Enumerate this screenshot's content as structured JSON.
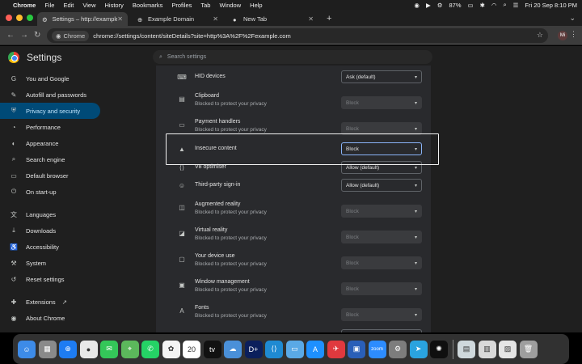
{
  "menubar": {
    "app": "Chrome",
    "items": [
      "File",
      "Edit",
      "View",
      "History",
      "Bookmarks",
      "Profiles",
      "Tab",
      "Window",
      "Help"
    ],
    "battery": "87%",
    "datetime": "Fri 20 Sep  8:10 PM"
  },
  "tabs": [
    {
      "title": "Settings – http://example.co",
      "active": true
    },
    {
      "title": "Example Domain",
      "active": false
    },
    {
      "title": "New Tab",
      "active": false
    }
  ],
  "toolbar": {
    "chip_label": "Chrome",
    "url": "chrome://settings/content/siteDetails?site=http%3A%2F%2Fexample.com",
    "avatar": "Mi"
  },
  "settings": {
    "title": "Settings",
    "search_placeholder": "Search settings",
    "nav": [
      {
        "label": "You and Google",
        "icon": "google-icon"
      },
      {
        "label": "Autofill and passwords",
        "icon": "autofill-icon"
      },
      {
        "label": "Privacy and security",
        "icon": "shield-icon",
        "active": true
      },
      {
        "label": "Performance",
        "icon": "performance-icon"
      },
      {
        "label": "Appearance",
        "icon": "palette-icon"
      },
      {
        "label": "Search engine",
        "icon": "search-icon"
      },
      {
        "label": "Default browser",
        "icon": "browser-icon"
      },
      {
        "label": "On start-up",
        "icon": "power-icon"
      },
      {
        "label": "Languages",
        "icon": "translate-icon"
      },
      {
        "label": "Downloads",
        "icon": "download-icon"
      },
      {
        "label": "Accessibility",
        "icon": "accessibility-icon"
      },
      {
        "label": "System",
        "icon": "wrench-icon"
      },
      {
        "label": "Reset settings",
        "icon": "reset-icon"
      },
      {
        "label": "Extensions",
        "icon": "puzzle-icon"
      },
      {
        "label": "About Chrome",
        "icon": "chrome-icon"
      }
    ]
  },
  "permissions": [
    {
      "label": "HID devices",
      "sub": "",
      "value": "Ask (default)",
      "disabled": false,
      "icon": "hid-icon"
    },
    {
      "label": "Clipboard",
      "sub": "Blocked to protect your privacy",
      "value": "Block",
      "disabled": true,
      "icon": "clipboard-icon"
    },
    {
      "label": "Payment handlers",
      "sub": "Blocked to protect your privacy",
      "value": "Block",
      "disabled": true,
      "icon": "payment-icon"
    },
    {
      "label": "Insecure content",
      "sub": "",
      "value": "Block",
      "disabled": false,
      "focused": true,
      "icon": "warning-icon"
    },
    {
      "label": "V8 optimiser",
      "sub": "",
      "value": "Allow (default)",
      "disabled": false,
      "icon": "code-icon"
    },
    {
      "label": "Third-party sign-in",
      "sub": "",
      "value": "Allow (default)",
      "disabled": false,
      "icon": "account-icon"
    },
    {
      "label": "Augmented reality",
      "sub": "Blocked to protect your privacy",
      "value": "Block",
      "disabled": true,
      "icon": "ar-icon"
    },
    {
      "label": "Virtual reality",
      "sub": "Blocked to protect your privacy",
      "value": "Block",
      "disabled": true,
      "icon": "vr-icon"
    },
    {
      "label": "Your device use",
      "sub": "Blocked to protect your privacy",
      "value": "Block",
      "disabled": true,
      "icon": "device-icon"
    },
    {
      "label": "Window management",
      "sub": "Blocked to protect your privacy",
      "value": "Block",
      "disabled": true,
      "icon": "window-icon"
    },
    {
      "label": "Fonts",
      "sub": "Blocked to protect your privacy",
      "value": "Block",
      "disabled": true,
      "icon": "font-icon"
    }
  ],
  "dock": [
    {
      "name": "finder",
      "color": "#3d8be8",
      "glyph": "☺"
    },
    {
      "name": "launchpad",
      "color": "#8a8a8a",
      "glyph": "▦"
    },
    {
      "name": "safari",
      "color": "#1e7cf2",
      "glyph": "⊕"
    },
    {
      "name": "chrome",
      "color": "#e8e8e8",
      "glyph": "●"
    },
    {
      "name": "messages",
      "color": "#34c759",
      "glyph": "✉"
    },
    {
      "name": "maps",
      "color": "#5cb85c",
      "glyph": "⌖"
    },
    {
      "name": "whatsapp",
      "color": "#25d366",
      "glyph": "✆"
    },
    {
      "name": "photos",
      "color": "#f4f4f4",
      "glyph": "✿"
    },
    {
      "name": "calendar",
      "color": "#ffffff",
      "glyph": "20"
    },
    {
      "name": "apple-tv",
      "color": "#111111",
      "glyph": "tv"
    },
    {
      "name": "weather",
      "color": "#4a90d9",
      "glyph": "☁"
    },
    {
      "name": "disney",
      "color": "#0b1f5c",
      "glyph": "D+"
    },
    {
      "name": "vscode",
      "color": "#1f8ad2",
      "glyph": "⟨⟩"
    },
    {
      "name": "folder",
      "color": "#5aa9e6",
      "glyph": "▭"
    },
    {
      "name": "app-store",
      "color": "#1e90ff",
      "glyph": "A"
    },
    {
      "name": "app-red",
      "color": "#e0393e",
      "glyph": "✈"
    },
    {
      "name": "remote-desktop",
      "color": "#2a5fb8",
      "glyph": "▣"
    },
    {
      "name": "zoom",
      "color": "#2d8cff",
      "glyph": "zoom"
    },
    {
      "name": "system-settings",
      "color": "#7d7d7d",
      "glyph": "⚙"
    },
    {
      "name": "telegram",
      "color": "#2aa3df",
      "glyph": "➤"
    },
    {
      "name": "chatgpt",
      "color": "#0f0f0f",
      "glyph": "✺"
    },
    {
      "name": "preview",
      "color": "#cfd8dc",
      "glyph": "▤"
    },
    {
      "name": "downloads-stack",
      "color": "#d9d9d9",
      "glyph": "▥"
    },
    {
      "name": "screenshots-stack",
      "color": "#e5e5e5",
      "glyph": "▨"
    },
    {
      "name": "trash",
      "color": "#9e9e9e",
      "glyph": "🗑"
    }
  ]
}
